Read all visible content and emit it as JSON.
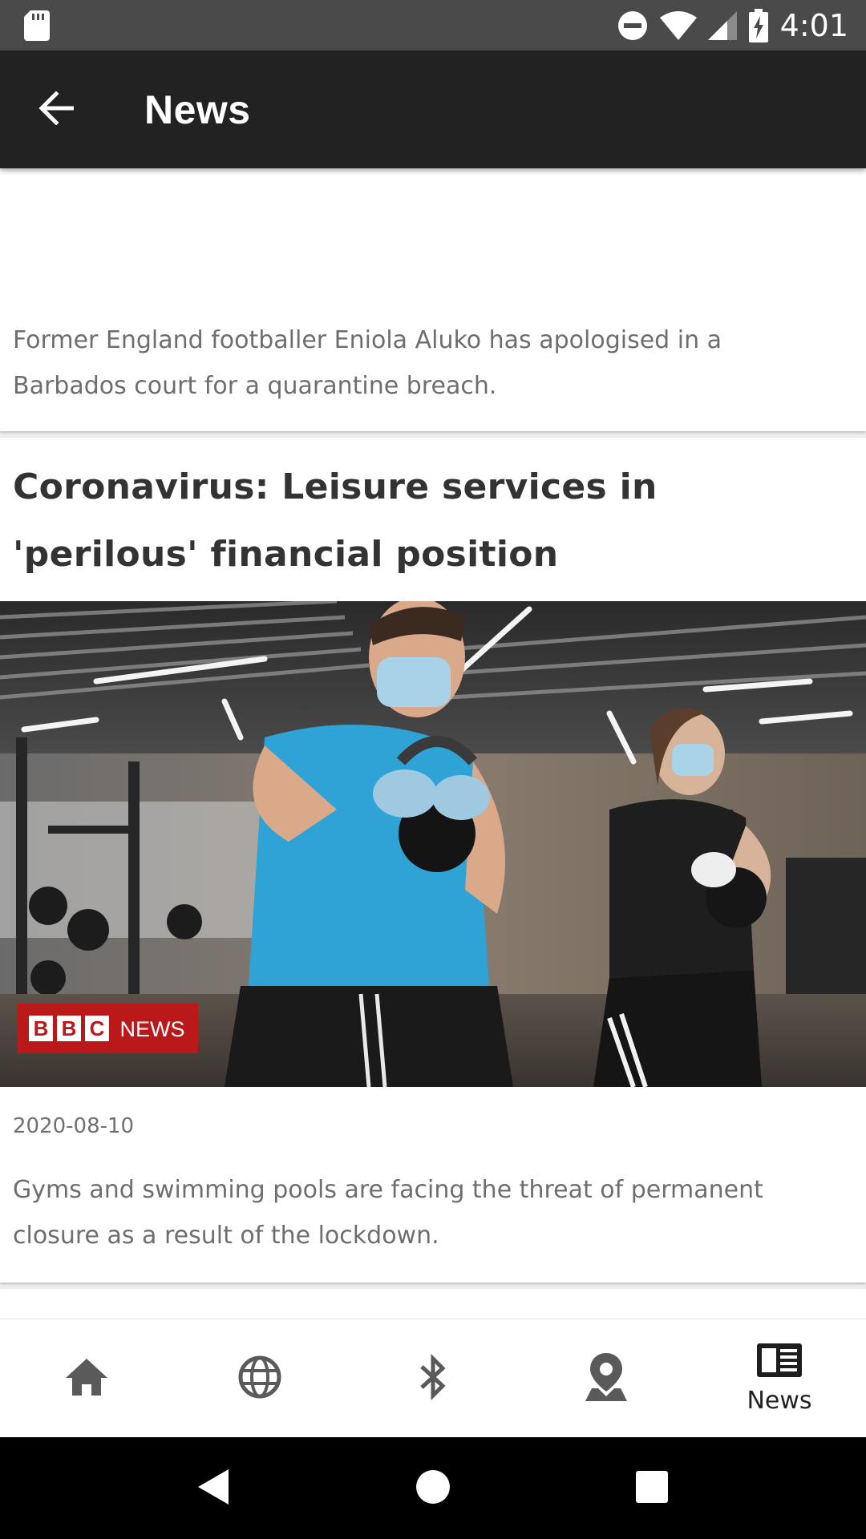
{
  "status_bar": {
    "time": "4:01"
  },
  "app_bar": {
    "title": "News"
  },
  "articles": [
    {
      "description": "Former England footballer Eniola Aluko has apologised in a Barbados court for a quarantine breach."
    },
    {
      "title": "Coronavirus: Leisure services in 'perilous' financial position",
      "image_badge": {
        "left_text": "BBC",
        "right_text": "NEWS",
        "color": "#bb1919"
      },
      "date": "2020-08-10",
      "description": "Gyms and swimming pools are facing the threat of permanent closure as a result of the lockdown."
    }
  ],
  "bottom_nav": {
    "items": [
      {
        "icon": "home-icon",
        "label": ""
      },
      {
        "icon": "globe-icon",
        "label": ""
      },
      {
        "icon": "bluetooth-icon",
        "label": ""
      },
      {
        "icon": "location-pin-icon",
        "label": ""
      },
      {
        "icon": "newspaper-icon",
        "label": "News"
      }
    ],
    "active_index": 4
  },
  "colors": {
    "status_bar": "#4a4a4a",
    "app_bar": "#222222",
    "bbc_red": "#bb1919"
  }
}
